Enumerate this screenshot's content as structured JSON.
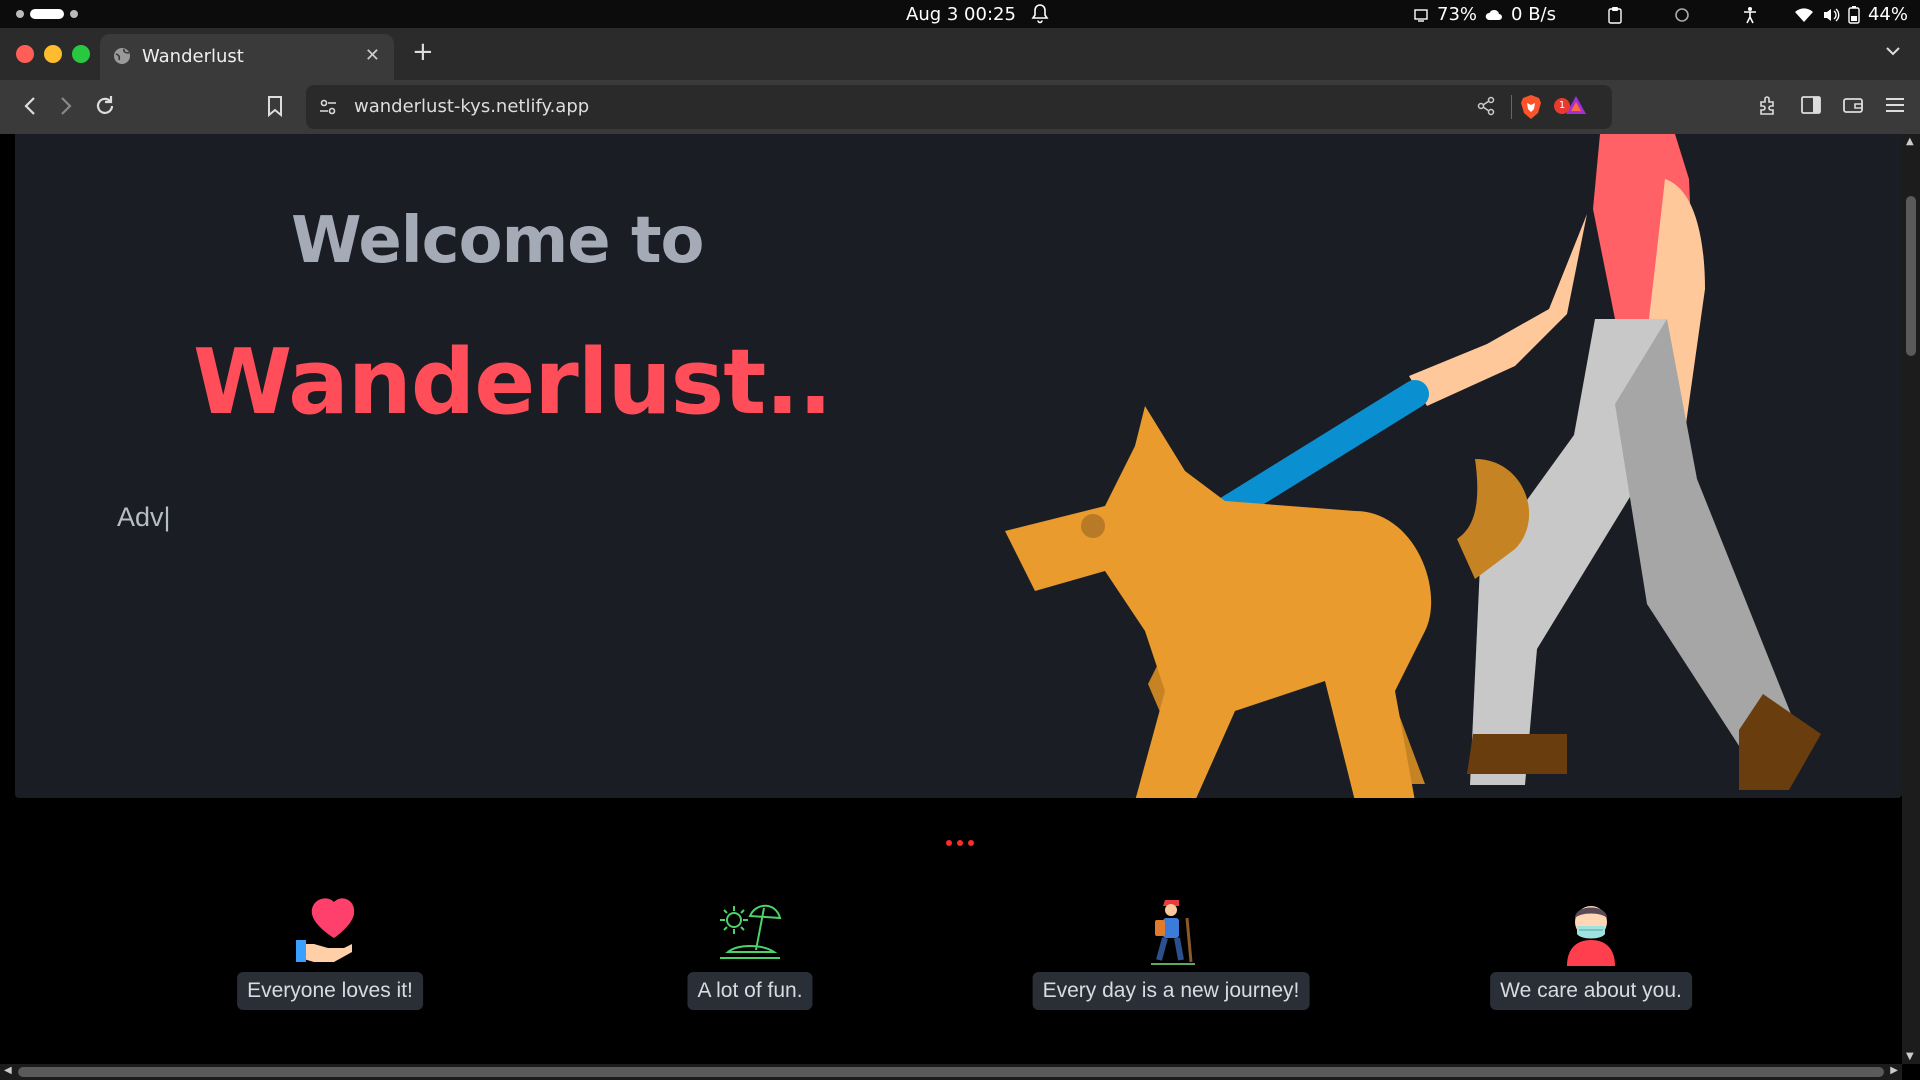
{
  "os": {
    "clock": "Aug 3  00:25",
    "cpu": "73%",
    "network": "0 B/s",
    "battery": "44%"
  },
  "browser": {
    "tab_title": "Wanderlust",
    "url": "wanderlust-kys.netlify.app",
    "rewards_badge": "1",
    "icons": [
      "back-icon",
      "forward-icon",
      "reload-icon",
      "bookmark-icon",
      "site-settings-icon",
      "share-icon",
      "brave-shields-icon",
      "brave-rewards-icon",
      "extensions-icon",
      "sidebar-icon",
      "wallet-icon",
      "menu-icon"
    ]
  },
  "hero": {
    "welcome": "Welcome to",
    "brand": "Wanderlust..",
    "typed_text": "Adv|"
  },
  "features": [
    {
      "caption": "Everyone loves it!",
      "icon": "heart-hand-icon"
    },
    {
      "caption": "A lot of fun.",
      "icon": "beach-umbrella-icon"
    },
    {
      "caption": "Every day is a new journey!",
      "icon": "hiker-icon"
    },
    {
      "caption": "We care about you.",
      "icon": "masked-person-icon"
    }
  ],
  "colors": {
    "brand": "#ff4d5a",
    "hero_bg": "#1a1d23",
    "welcome_text": "#a5abb6",
    "caption_bg": "#2a2e36",
    "dots": "#ff2a2a"
  }
}
